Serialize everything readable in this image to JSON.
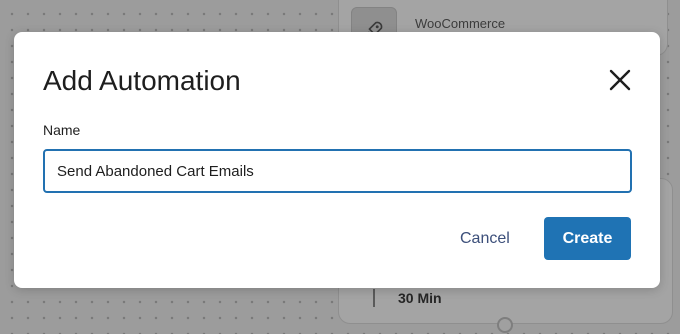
{
  "background": {
    "trigger_card": {
      "title": "WooCommerce",
      "icon": "rocket-icon"
    },
    "delay_card": {
      "value": "30 Min"
    }
  },
  "modal": {
    "title": "Add Automation",
    "close_icon": "close-icon",
    "name_label": "Name",
    "name_value": "Send Abandoned Cart Emails",
    "cancel_label": "Cancel",
    "create_label": "Create"
  },
  "colors": {
    "primary": "#1f73b4",
    "input_focus_border": "#2271b1",
    "cancel_text": "#3c4f7a",
    "overlay": "#9c9c9c"
  }
}
